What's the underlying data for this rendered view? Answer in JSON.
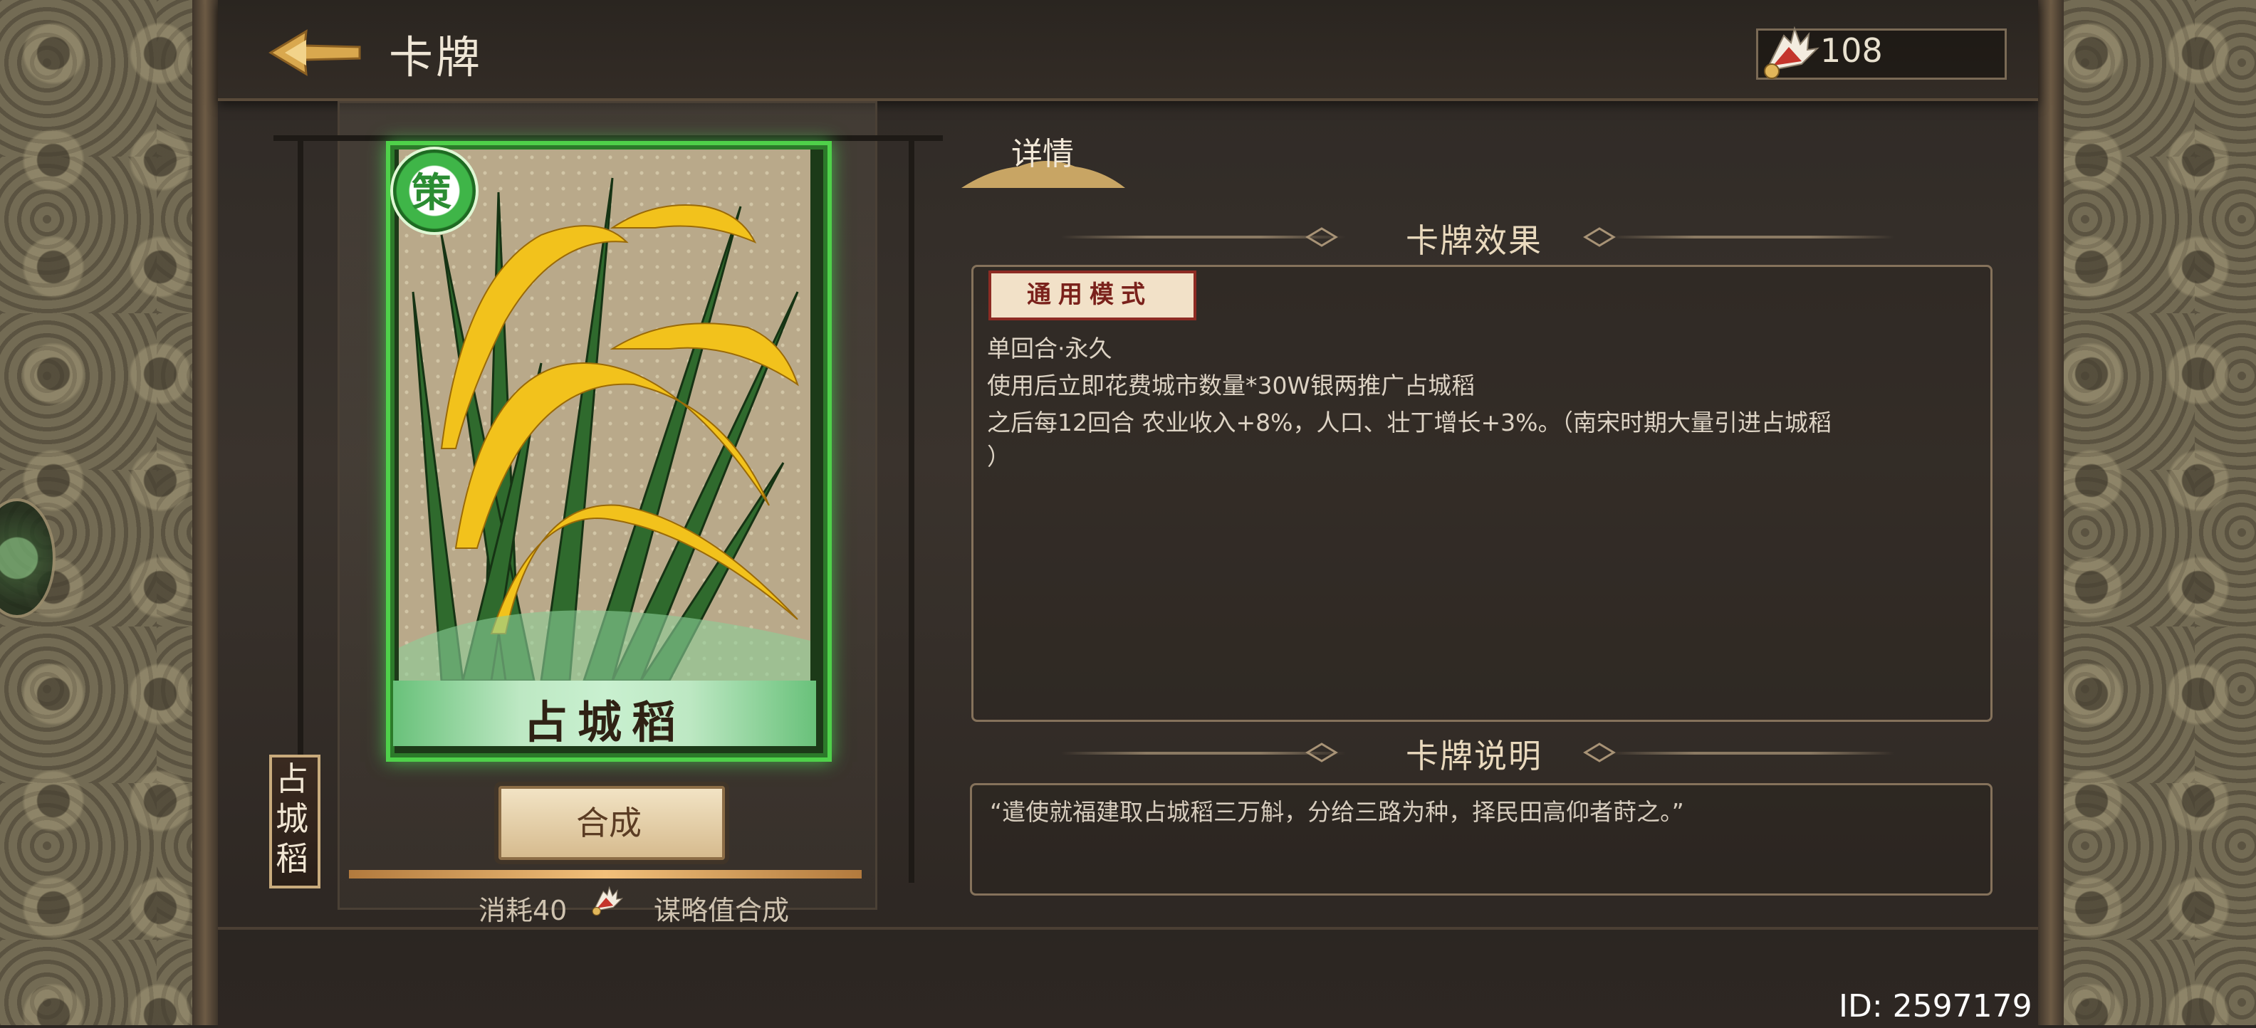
{
  "header": {
    "title": "卡牌",
    "currency_value": "108"
  },
  "card": {
    "name": "占城稻",
    "vertical_name": "占\n城\n稻",
    "badge_char": "策",
    "compose_label": "合成",
    "cost_text_prefix": "消耗40",
    "cost_text_suffix": "谋略值合成"
  },
  "detail": {
    "tab_label": "详情",
    "effects_title": "卡牌效果",
    "mode_badge": "通用模式",
    "effect_lines": [
      "单回合·永久",
      "使用后立即花费城市数量*30W银两推广占城稻",
      "之后每12回合 农业收入+8%，人口、壮丁增长+3%。（南宋时期大量引进占城稻",
      "）"
    ],
    "description_title": "卡牌说明",
    "description_text": "“遣使就福建取占城稻三万斛，分给三路为种，择民田高仰者莳之。”"
  },
  "footer": {
    "player_id": "ID: 2597179"
  },
  "colors": {
    "card_rarity_green": "#4fd14a",
    "title_text": "#efe6d6",
    "mode_badge_red": "#8d2b23"
  }
}
